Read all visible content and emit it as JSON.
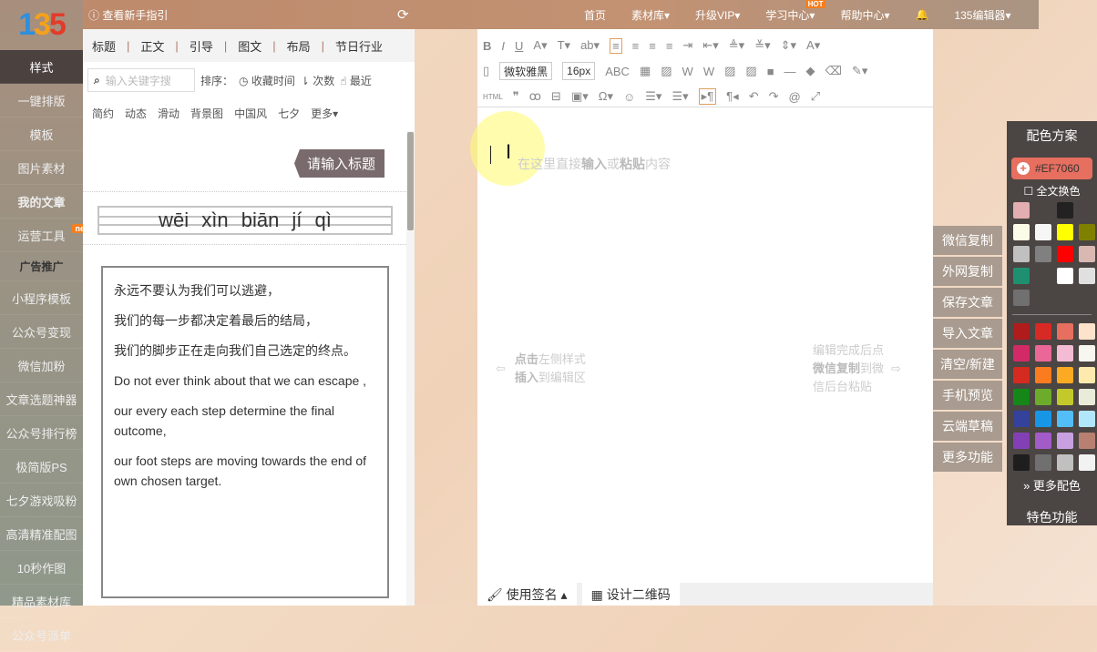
{
  "logo": {
    "text": "135"
  },
  "sidebar": {
    "items": [
      {
        "label": "样式",
        "active": true
      },
      {
        "label": "一键排版"
      },
      {
        "label": "模板"
      },
      {
        "label": "图片素材"
      },
      {
        "label": "我的文章",
        "bold": true
      },
      {
        "label": "运营工具",
        "badge": "new"
      },
      {
        "label": "广告推广",
        "section": true
      },
      {
        "label": "小程序模板"
      },
      {
        "label": "公众号变现"
      },
      {
        "label": "微信加粉"
      },
      {
        "label": "文章选题神器"
      },
      {
        "label": "公众号排行榜"
      },
      {
        "label": "极简版PS"
      },
      {
        "label": "七夕游戏吸粉"
      },
      {
        "label": "高清精准配图"
      },
      {
        "label": "10秒作图"
      },
      {
        "label": "精品素材库"
      },
      {
        "label": "公众号派单"
      }
    ]
  },
  "topbar": {
    "guide": "查看新手指引",
    "nav": [
      {
        "label": "首页"
      },
      {
        "label": "素材库▾"
      },
      {
        "label": "升级VIP▾"
      },
      {
        "label": "学习中心▾",
        "badge": "HOT"
      },
      {
        "label": "帮助中心▾"
      },
      {
        "label": "🔔"
      },
      {
        "label": "135编辑器▾"
      }
    ]
  },
  "panel": {
    "tabs": [
      "标题",
      "正文",
      "引导",
      "图文",
      "布局",
      "节日行业"
    ],
    "search_placeholder": "输入关键字搜",
    "sort_label": "排序：",
    "sort": [
      "◷ 收藏时间",
      "⇂ 次数",
      "☝ 最近"
    ],
    "categories": [
      "简约",
      "动态",
      "滑动",
      "背景图",
      "中国风",
      "七夕",
      "更多▾"
    ],
    "title_tag": "请输入标题",
    "pinyin": "wēi xìn biān jí qì",
    "poem": [
      "永远不要认为我们可以逃避，",
      "我们的每一步都决定着最后的结局，",
      "我们的脚步正在走向我们自己选定的终点。",
      "Do not ever think about that we can escape ,",
      "our every each step determine the final outcome,",
      "our foot steps are moving towards the end of own chosen target."
    ]
  },
  "editor": {
    "font": "微软雅黑",
    "size": "16px",
    "row1": [
      "B",
      "I",
      "U",
      "A▾",
      "T▾",
      "ab▾",
      "≡",
      "≡",
      "≡",
      "≡",
      "⇥",
      "⇤▾",
      "≜▾",
      "≚▾",
      "⇕▾",
      "A▾"
    ],
    "row2": [
      "▯",
      "ABC",
      "▦",
      "▨",
      "W",
      "W",
      "▨",
      "▨",
      "■",
      "—",
      "◆",
      "⌫",
      "✎▾"
    ],
    "row3": [
      "HTML",
      "❞",
      "ꝏ",
      "⊟",
      "▣▾",
      "Ω▾",
      "☺",
      "☰▾",
      "☰▾",
      "▸¶",
      "¶◂",
      "↶",
      "↷",
      "@",
      "⤢"
    ],
    "placeholder": {
      "pre": "在这里直接",
      "b1": "输入",
      "mid": "或",
      "b2": "粘贴",
      "post": "内容"
    },
    "hint_left": {
      "b1": "点击",
      "t1": "左侧样式",
      "b2": "插入",
      "t2": "到编辑区"
    },
    "hint_right": {
      "t1": "编辑完成后点",
      "b1": "微信复制",
      "t2": "到微",
      "t3": "信后台粘贴"
    },
    "bottom": [
      "🖌 使用签名 ▴",
      "▦ 设计二维码"
    ]
  },
  "actions": [
    "微信复制",
    "外网复制",
    "保存文章",
    "导入文章",
    "清空/新建",
    "手机预览",
    "云端草稿",
    "更多功能"
  ],
  "colors": {
    "title": "配色方案",
    "current": "#EF7060",
    "fullswap": "全文换色",
    "more": "更多配色",
    "special": "特色功能",
    "recent": [
      "#e3aeb1",
      "transparent",
      "#222222",
      "transparent",
      "#fbfbe8",
      "#f6f6f6",
      "#ffff00",
      "#808000",
      "#c0c0c0",
      "#808080",
      "#ff0000",
      "#d8b8b0",
      "#1e9070",
      "transparent",
      "#ffffff",
      "#e0e0e0",
      "#707070"
    ],
    "palette": [
      "#b01c1c",
      "#d82a24",
      "#e66f5f",
      "#fde3cc",
      "#d22a66",
      "#ea6797",
      "#f4bcd4",
      "#f7f7ef",
      "#d52a1f",
      "#fb7c1e",
      "#fcaa22",
      "#feeaad",
      "#158618",
      "#6dac2b",
      "#c3c92b",
      "#e8ecd8",
      "#34429c",
      "#1896e6",
      "#52bdf6",
      "#b2e6fb",
      "#8340b5",
      "#a35bc8",
      "#c8a0df",
      "#b78070",
      "#1e1e1e",
      "#707070",
      "#c0c0c0",
      "#f2f2f2"
    ]
  }
}
